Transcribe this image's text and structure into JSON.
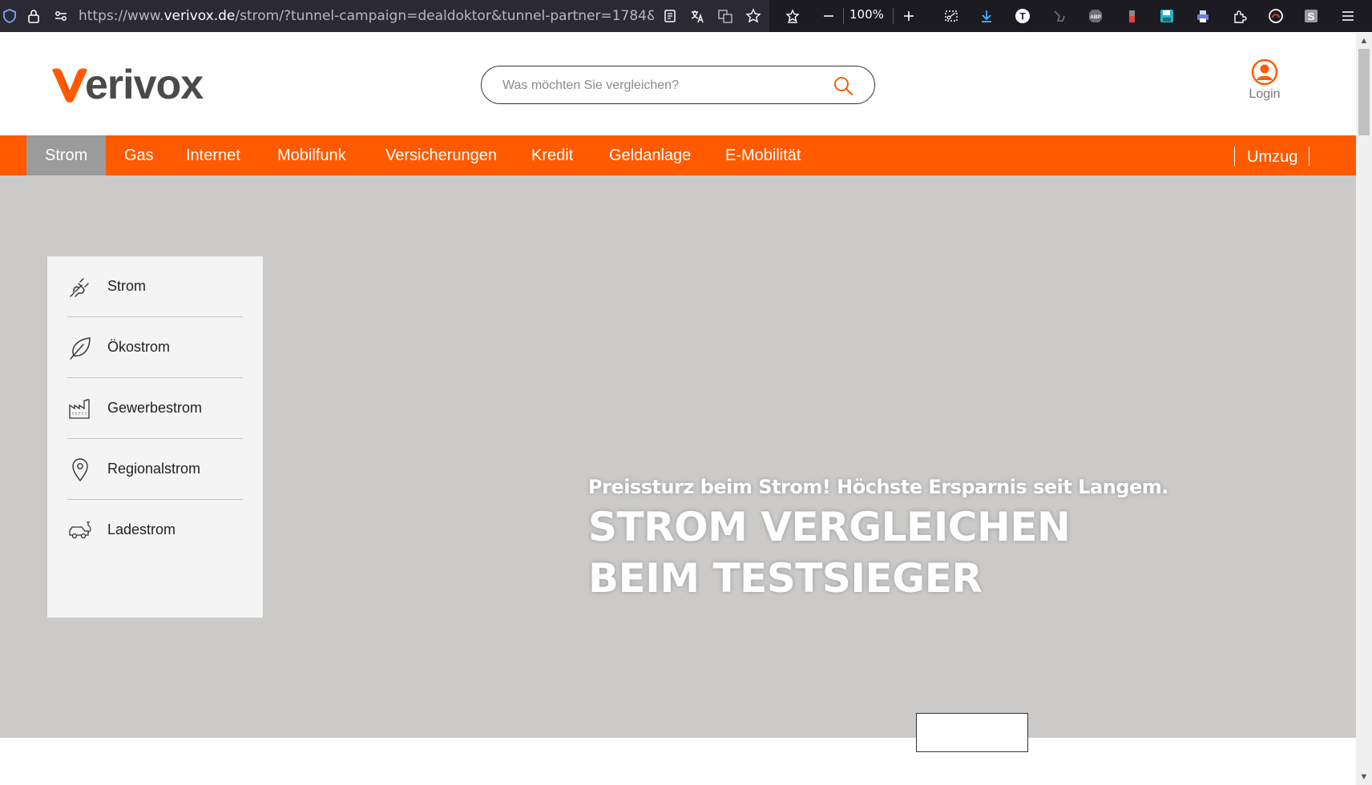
{
  "browser": {
    "url_prefix": "https://www.",
    "url_host": "verivox.de",
    "url_rest": "/strom/?tunnel-campaign=dealdoktor&tunnel-partner=1784&tunnel-su",
    "zoom": "100%"
  },
  "header": {
    "search_placeholder": "Was möchten Sie vergleichen?",
    "login_label": "Login"
  },
  "nav": {
    "items": [
      "Strom",
      "Gas",
      "Internet",
      "Mobilfunk",
      "Versicherungen",
      "Kredit",
      "Geldanlage",
      "E-Mobilität"
    ],
    "umzug": "Umzug"
  },
  "sidemenu": {
    "items": [
      {
        "label": "Strom",
        "icon": "plug-icon"
      },
      {
        "label": "Ökostrom",
        "icon": "leaf-icon"
      },
      {
        "label": "Gewerbestrom",
        "icon": "factory-icon"
      },
      {
        "label": "Regionalstrom",
        "icon": "map-pin-icon"
      },
      {
        "label": "Ladestrom",
        "icon": "electric-car-icon"
      }
    ]
  },
  "hero": {
    "kicker": "Preissturz beim Strom! Höchste Ersparnis seit Langem.",
    "headline": "STROM VERGLEICHEN BEIM TESTSIEGER"
  },
  "colors": {
    "brand_orange": "#ff5a00",
    "nav_active": "#9b9b9b",
    "hero_bg": "#cbcac9"
  }
}
